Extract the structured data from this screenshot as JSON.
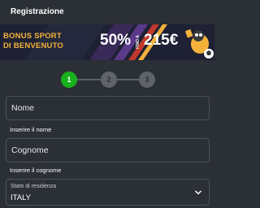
{
  "header": {
    "title": "Registrazione"
  },
  "banner": {
    "line1": "BONUS SPORT",
    "line2": "DI BENVENUTO",
    "percent": "50%",
    "fino_a": "FINO A",
    "amount": "215€",
    "text_color": "#f4b23a"
  },
  "steps": [
    "1",
    "2",
    "3"
  ],
  "active_step": 1,
  "form": {
    "nome": {
      "placeholder": "Nome",
      "hint": "Inserire il nome"
    },
    "cognome": {
      "placeholder": "Cognome",
      "hint": "Inserire il cognome"
    },
    "residenza": {
      "label": "Stato di residenza",
      "value": "ITALY"
    }
  },
  "colors": {
    "background": "#2b2f36",
    "active_step": "#19b11d",
    "inactive_step": "#5f636b",
    "field_border": "#4d525a"
  }
}
